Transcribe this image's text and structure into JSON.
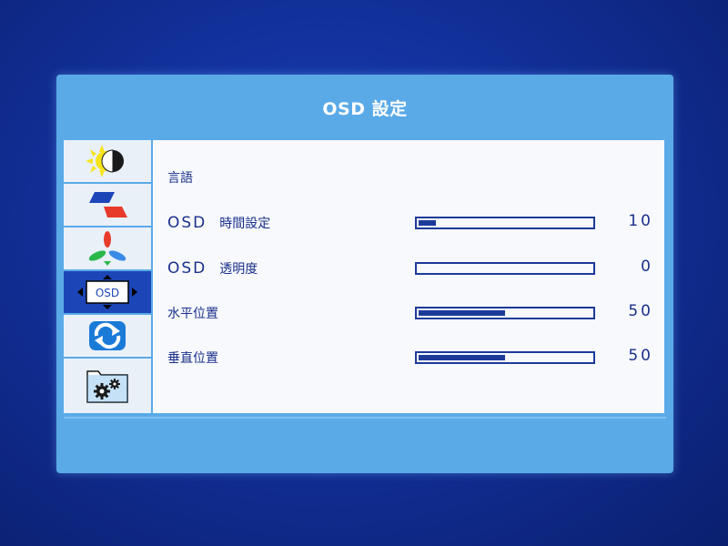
{
  "window": {
    "title": "OSD 設定"
  },
  "sidebar": {
    "tabs": [
      {
        "icon": "brightness-contrast-icon",
        "active": false
      },
      {
        "icon": "color-adjust-icon",
        "active": false
      },
      {
        "icon": "rgb-color-icon",
        "active": false
      },
      {
        "icon": "osd-settings-icon",
        "active": true,
        "icon_text": "OSD"
      },
      {
        "icon": "reset-icon",
        "active": false
      },
      {
        "icon": "system-settings-icon",
        "active": false
      }
    ]
  },
  "menu": {
    "items": [
      {
        "label": "言語",
        "prefix": "",
        "value": "",
        "level": null
      },
      {
        "label": "時間設定",
        "prefix": "OSD",
        "value": "10",
        "level": 10
      },
      {
        "label": "透明度",
        "prefix": "OSD",
        "value": "0",
        "level": 0
      },
      {
        "label": "水平位置",
        "prefix": "",
        "value": "50",
        "level": 50
      },
      {
        "label": "垂直位置",
        "prefix": "",
        "value": "50",
        "level": 50
      }
    ]
  },
  "colors": {
    "panel": "#5aaae8",
    "accent": "#1c46b8",
    "text": "#1a2f8a",
    "content_bg": "#f7f9fc"
  }
}
